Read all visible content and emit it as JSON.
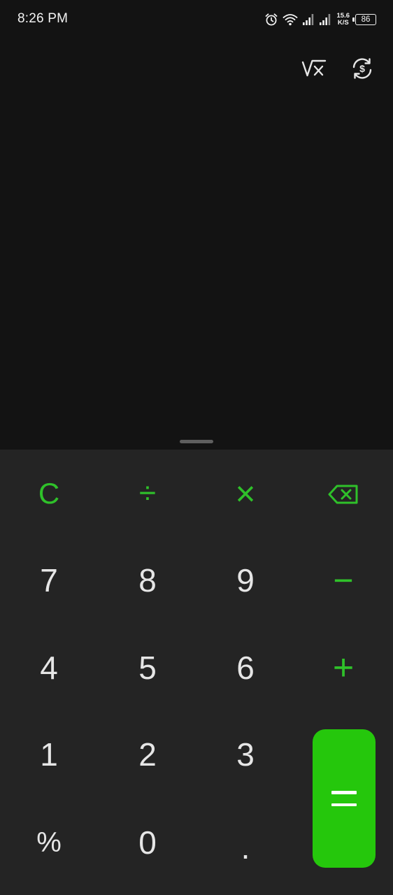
{
  "status_bar": {
    "time": "8:26 PM",
    "net_speed_value": "15.6",
    "net_speed_unit": "K/S",
    "battery_level": "86",
    "icons": [
      "alarm-icon",
      "wifi-icon",
      "signal-icon",
      "signal-icon"
    ]
  },
  "toolbar": {
    "scientific_icon": "square-root-x-icon",
    "currency_icon": "currency-convert-icon"
  },
  "keypad": {
    "clear": "C",
    "divide": "÷",
    "multiply": "×",
    "backspace_icon": "backspace-icon",
    "subtract": "−",
    "add": "+",
    "percent": "%",
    "decimal": ".",
    "digits": {
      "zero": "0",
      "one": "1",
      "two": "2",
      "three": "3",
      "four": "4",
      "five": "5",
      "six": "6",
      "seven": "7",
      "eight": "8",
      "nine": "9"
    },
    "equals_icon": "equals-icon"
  },
  "colors": {
    "accent": "#2fc12a",
    "equals_background": "#25c70c",
    "display_background": "#131313",
    "keypad_background": "#242424",
    "digit_text": "#e6e6e6"
  }
}
